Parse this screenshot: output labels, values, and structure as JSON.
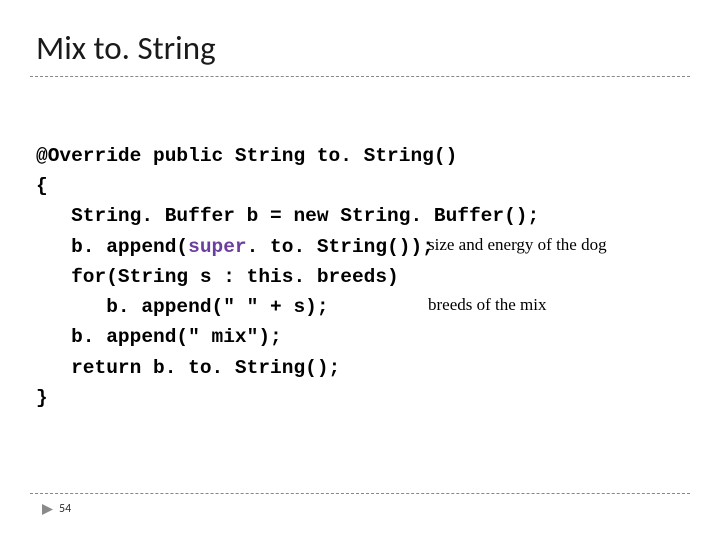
{
  "title": "Mix to. String",
  "code": {
    "l1": "@Override public String to. String()",
    "l2": "{",
    "l3": "   String. Buffer b = new String. Buffer();",
    "l4a": "   b. append(",
    "l4_super": "super",
    "l4b": ". to. String());",
    "l5": "   for(String s : this. breeds)",
    "l6": "      b. append(\" \" + s);",
    "l7": "   b. append(\" mix\");",
    "l8": "   return b. to. String();",
    "l9": "}"
  },
  "annotations": {
    "size_energy": "size and energy of the dog",
    "breeds": "breeds of the mix"
  },
  "page_number": "54"
}
